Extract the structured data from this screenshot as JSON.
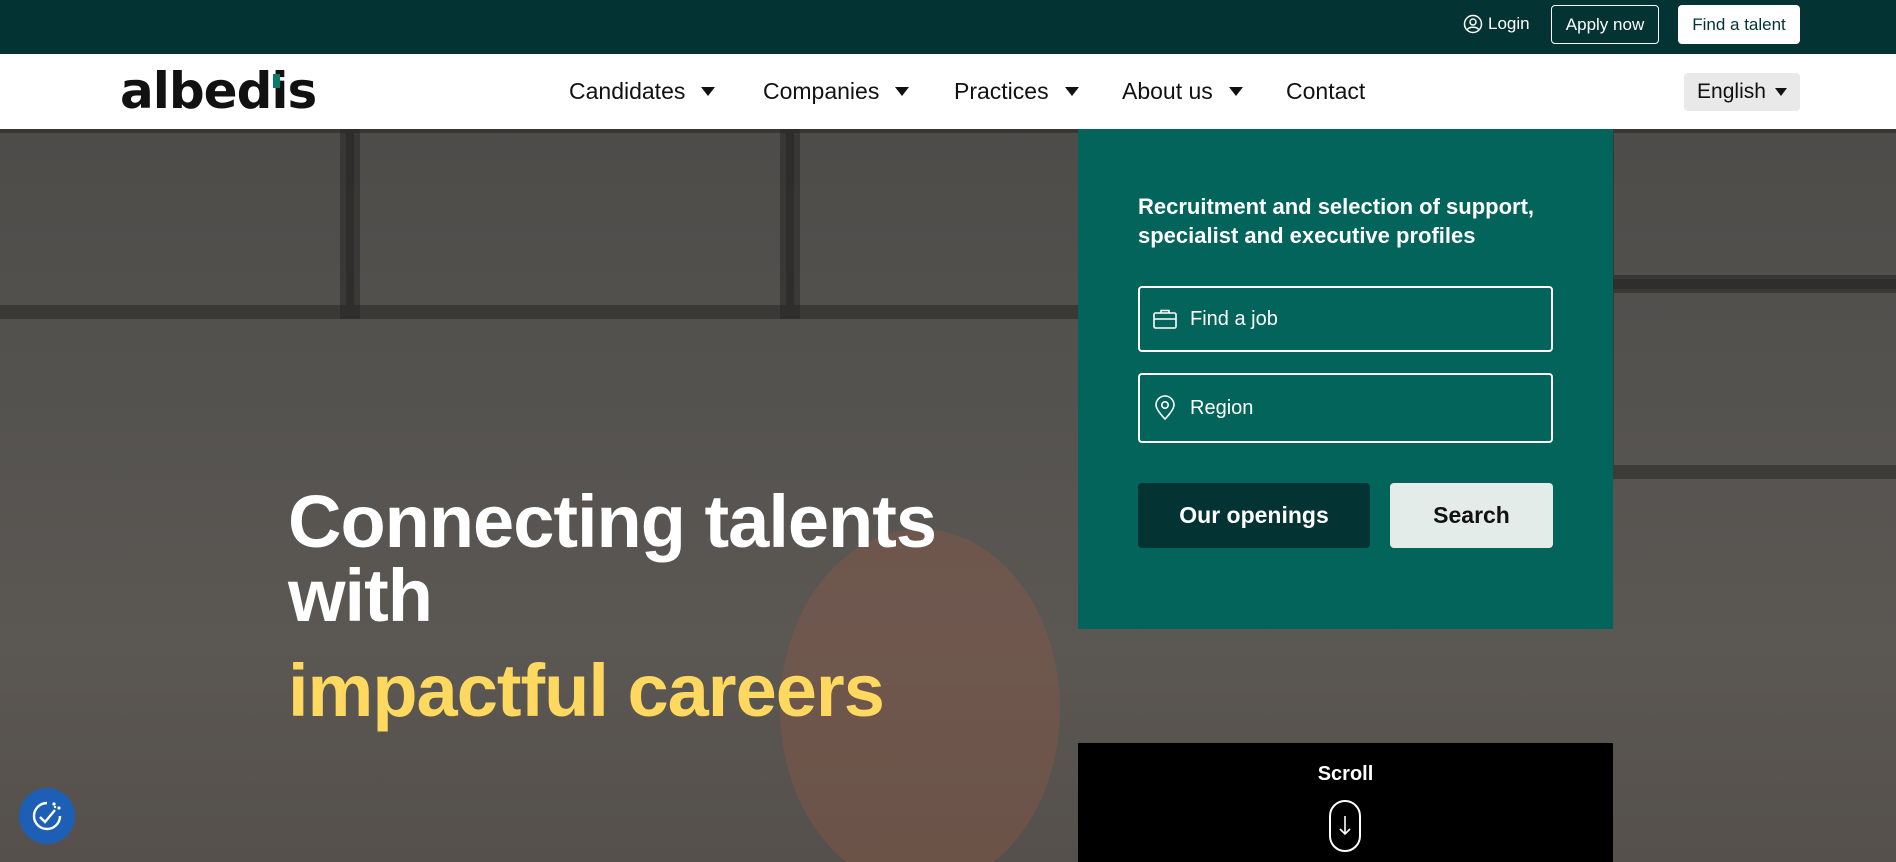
{
  "topbar": {
    "login_label": "Login",
    "apply_label": "Apply now",
    "find_talent_label": "Find a talent"
  },
  "header": {
    "logo_text": "albedis",
    "nav": [
      {
        "label": "Candidates",
        "has_dropdown": true
      },
      {
        "label": "Companies",
        "has_dropdown": true
      },
      {
        "label": "Practices",
        "has_dropdown": true
      },
      {
        "label": "About us",
        "has_dropdown": true
      },
      {
        "label": "Contact",
        "has_dropdown": false
      }
    ],
    "language": "English"
  },
  "hero": {
    "line1": "Connecting talents",
    "line2": "with",
    "line3": "impactful careers"
  },
  "search_panel": {
    "headline": "Recruitment and selection of support, specialist and executive profiles",
    "job_placeholder": "Find a job",
    "region_placeholder": "Region",
    "openings_label": "Our openings",
    "search_label": "Search"
  },
  "scroll": {
    "label": "Scroll"
  },
  "icons": {
    "login": "user-circle-icon",
    "job": "briefcase-icon",
    "region": "location-pin-icon",
    "scroll": "arrow-down-icon",
    "cookie": "cookie-settings-icon"
  },
  "colors": {
    "topbar_bg": "#033332",
    "panel_bg": "#02645a",
    "highlight_yellow": "#ffd85f",
    "cookie_blue": "#1d5fb5"
  }
}
